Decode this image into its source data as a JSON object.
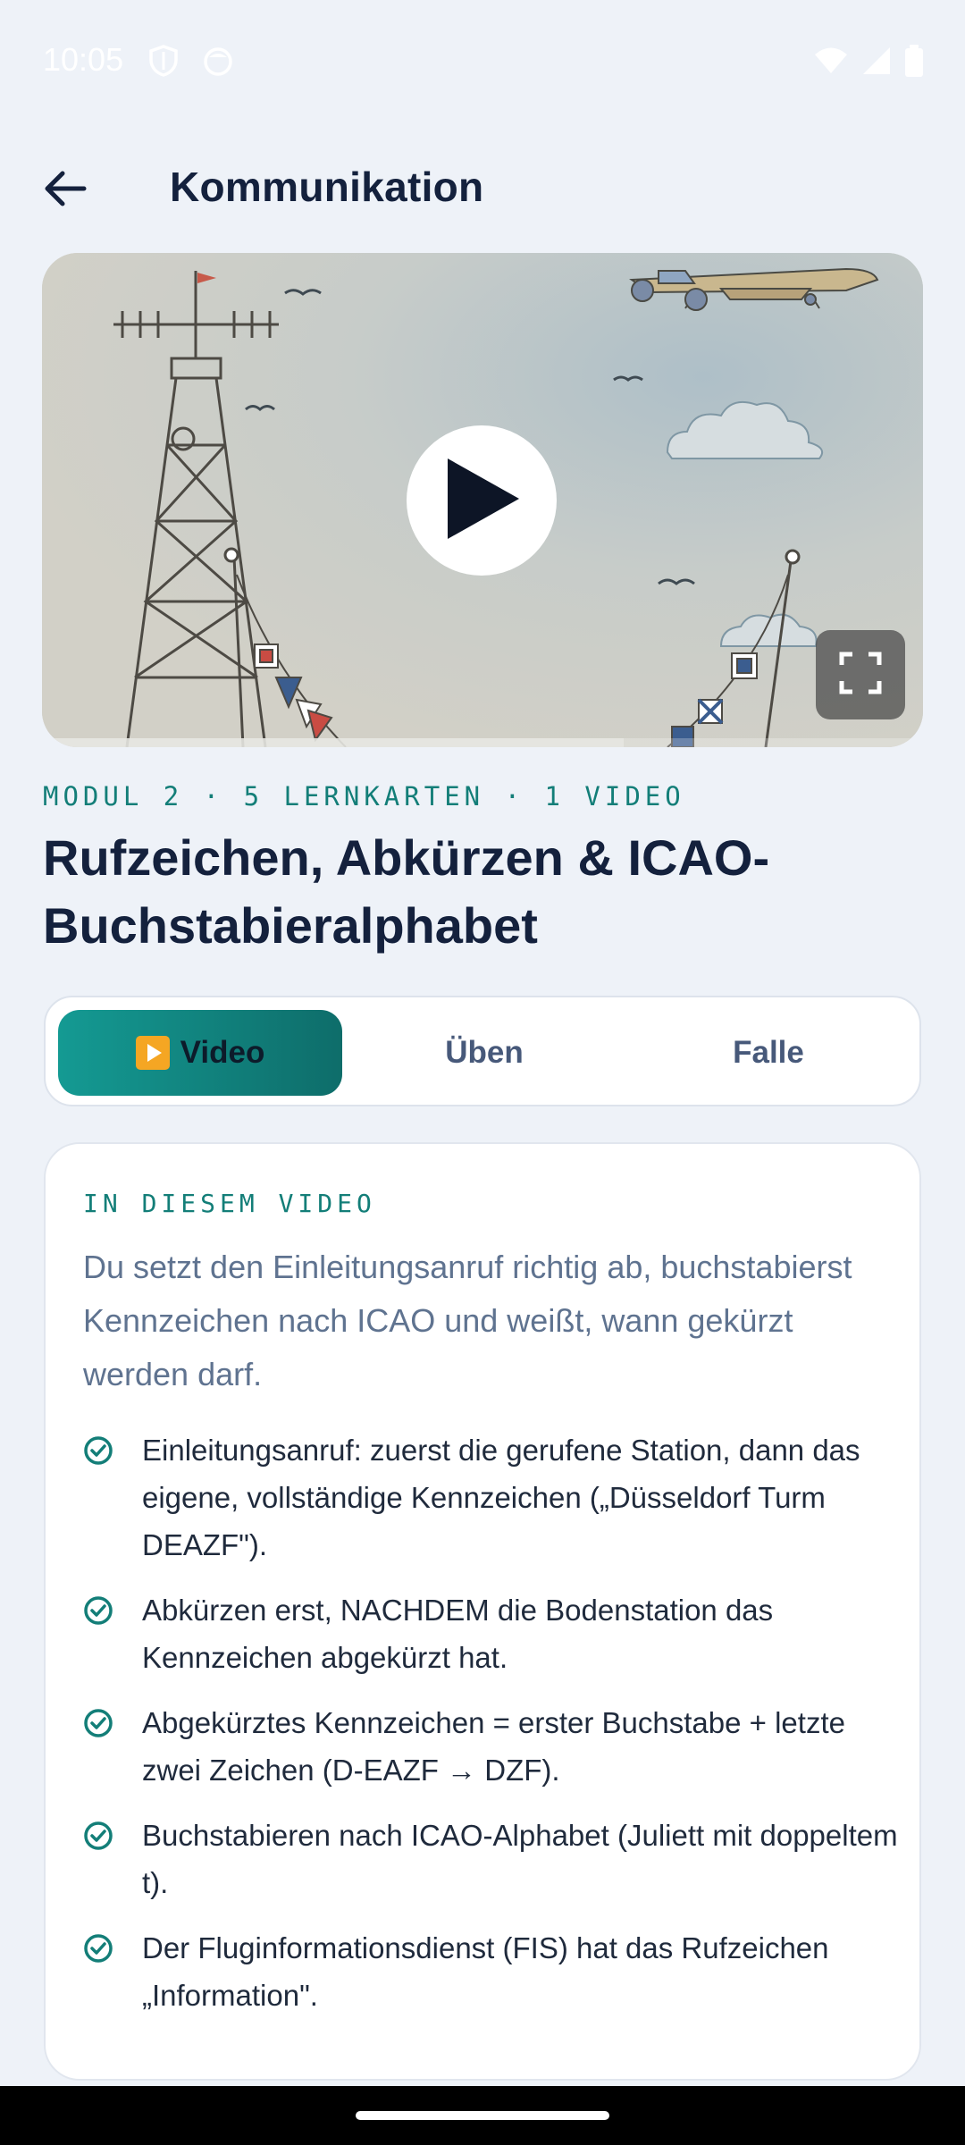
{
  "status_bar": {
    "time": "10:05",
    "left_icons": [
      "shield-icon",
      "face-icon"
    ],
    "right_icons": [
      "wifi-icon",
      "signal-icon",
      "battery-icon"
    ]
  },
  "header": {
    "title": "Kommunikation",
    "back_icon": "arrow-left-icon"
  },
  "video": {
    "play_icon": "play-icon",
    "fullscreen_icon": "fullscreen-icon",
    "progress": 0.66
  },
  "lesson": {
    "meta": "MODUL 2 · 5 LERNKARTEN · 1 VIDEO",
    "title": "Rufzeichen, Abkürzen & ICAO-Buchstabieralphabet"
  },
  "tabs": [
    {
      "label": "Video",
      "icon": "play-button-emoji",
      "active": true
    },
    {
      "label": "Üben",
      "active": false
    },
    {
      "label": "Falle",
      "active": false
    }
  ],
  "summary": {
    "label": "IN DIESEM VIDEO",
    "intro": "Du setzt den Einleitungsanruf richtig ab, buchstabierst Kennzeichen nach ICAO und weißt, wann gekürzt werden darf.",
    "points": [
      "Einleitungsanruf: zuerst die gerufene Station, dann das eigene, vollständige Kennzeichen („Düsseldorf Turm DEAZF\").",
      "Abkürzen erst, NACHDEM die Bodenstation das Kennzeichen abgekürzt hat.",
      "Abgekürztes Kennzeichen = erster Buchstabe + letzte zwei Zeichen (D-EAZF → DZF).",
      "Buchstabieren nach ICAO-Alphabet (Juliett mit doppeltem t).",
      "Der Fluginformationsdienst (FIS) hat das Rufzeichen „Information\"."
    ]
  },
  "colors": {
    "accent": "#137e78",
    "background": "#eef2f8",
    "title": "#14213d"
  }
}
